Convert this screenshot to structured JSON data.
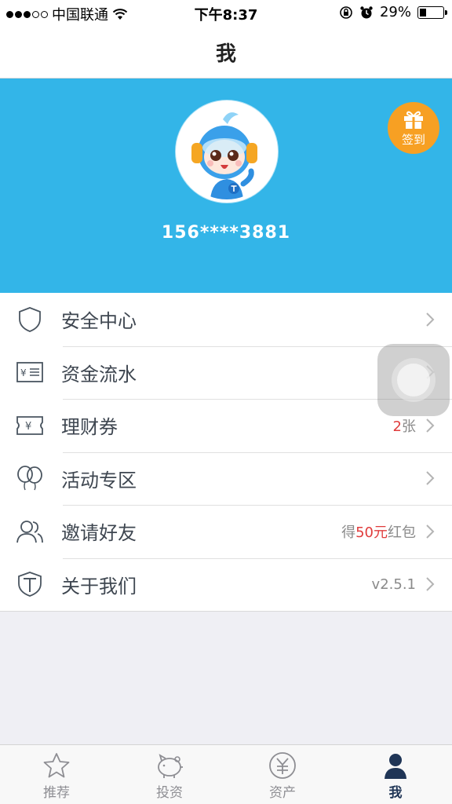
{
  "status_bar": {
    "carrier": "中国联通",
    "time": "下午8:37",
    "battery": "29%",
    "battery_level": 0.29
  },
  "nav": {
    "title": "我"
  },
  "profile": {
    "phone": "156****3881",
    "sign_label": "签到"
  },
  "menu": {
    "security": {
      "label": "安全中心",
      "icon": "shield-icon"
    },
    "funds": {
      "label": "资金流水",
      "icon": "ledger-icon"
    },
    "coupons": {
      "label": "理财券",
      "icon": "ticket-icon",
      "count": "2",
      "unit": "张"
    },
    "activities": {
      "label": "活动专区",
      "icon": "balloons-icon"
    },
    "invite": {
      "label": "邀请好友",
      "icon": "users-icon",
      "prefix": "得",
      "amount": "50元",
      "suffix": "红包"
    },
    "about": {
      "label": "关于我们",
      "icon": "brand-shield-icon",
      "version": "v2.5.1"
    }
  },
  "tabs": [
    {
      "label": "推荐",
      "icon": "star-icon",
      "active": false
    },
    {
      "label": "投资",
      "icon": "piggy-bank-icon",
      "active": false
    },
    {
      "label": "资产",
      "icon": "yuan-coin-icon",
      "active": false
    },
    {
      "label": "我",
      "icon": "person-icon",
      "active": true
    }
  ],
  "colors": {
    "header_bg": "#33b5e8",
    "sign_bg": "#f7a023",
    "highlight": "#e03c3c",
    "tab_active": "#1f3556"
  }
}
